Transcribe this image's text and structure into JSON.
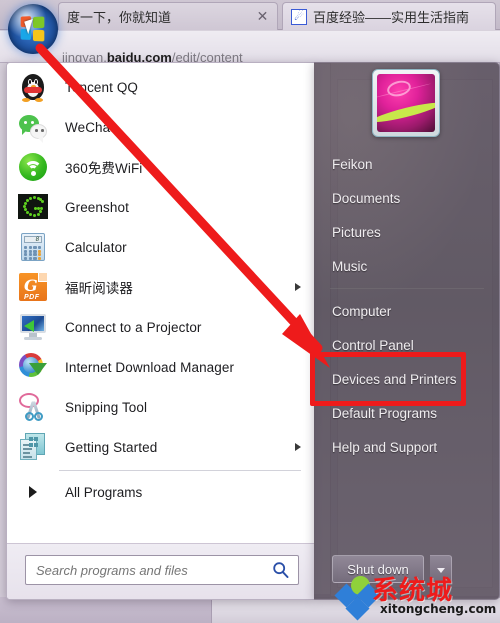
{
  "browser": {
    "tabs": [
      {
        "label": "度一下，你就知道",
        "favicon": "",
        "active": false,
        "closable": true
      },
      {
        "label": "百度经验——实用生活指南",
        "favicon": "paw-icon",
        "active": true,
        "closable": false
      }
    ],
    "url_prefix": "jingyan.",
    "url_host": "baidu.com",
    "url_path": "/edit/content"
  },
  "start_orb": {
    "name": "Start",
    "cursor_visible": true
  },
  "start_menu": {
    "programs": [
      {
        "label": "Tencent QQ",
        "icon": "qq-icon",
        "submenu": false
      },
      {
        "label": "WeChat",
        "icon": "wechat-icon",
        "submenu": false
      },
      {
        "label": "360免费WiFi",
        "icon": "360-wifi-icon",
        "submenu": false
      },
      {
        "label": "Greenshot",
        "icon": "greenshot-icon",
        "submenu": false
      },
      {
        "label": "Calculator",
        "icon": "calculator-icon",
        "submenu": false
      },
      {
        "label": "福昕阅读器",
        "icon": "foxit-pdf-icon",
        "submenu": true
      },
      {
        "label": "Connect to a Projector",
        "icon": "projector-icon",
        "submenu": false
      },
      {
        "label": "Internet Download Manager",
        "icon": "idm-icon",
        "submenu": false
      },
      {
        "label": "Snipping Tool",
        "icon": "snipping-tool-icon",
        "submenu": false
      },
      {
        "label": "Getting Started",
        "icon": "getting-started-icon",
        "submenu": true
      }
    ],
    "all_programs_label": "All Programs",
    "search": {
      "placeholder": "Search programs and files",
      "value": "",
      "icon": "search-icon"
    },
    "right_panel": {
      "user_name": "Feikon",
      "avatar_icon": "user-avatar",
      "items": [
        {
          "label": "Feikon",
          "divider_after": false
        },
        {
          "label": "Documents",
          "divider_after": false
        },
        {
          "label": "Pictures",
          "divider_after": false
        },
        {
          "label": "Music",
          "divider_after": true
        },
        {
          "label": "Computer",
          "divider_after": false
        },
        {
          "label": "Control Panel",
          "divider_after": false,
          "highlighted": true
        },
        {
          "label": "Devices and Printers",
          "divider_after": false
        },
        {
          "label": "Default Programs",
          "divider_after": false
        },
        {
          "label": "Help and Support",
          "divider_after": false
        }
      ],
      "shutdown_label": "Shut down",
      "shutdown_caret_icon": "chevron-down-icon"
    }
  },
  "annotations": {
    "arrow_color": "#ee1b1b",
    "highlight_color": "#ee1b1b",
    "highlight_target": "Control Panel"
  },
  "watermark": {
    "title": "系统城",
    "domain": "xitongcheng.com",
    "title_color": "#ee1b1b"
  }
}
